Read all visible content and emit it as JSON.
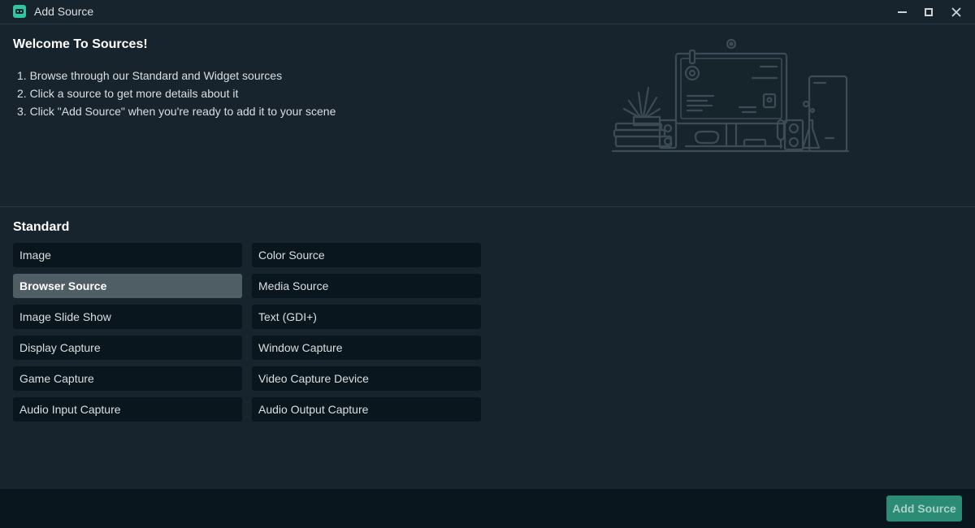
{
  "window": {
    "title": "Add Source",
    "icon": "streamlabs-robot-icon"
  },
  "welcome": {
    "title": "Welcome To Sources!",
    "steps": [
      "1. Browse through our Standard and Widget sources",
      "2. Click a source to get more details about it",
      "3. Click \"Add Source\" when you're ready to add it to your scene"
    ],
    "illustration": "desk-setup-illustration"
  },
  "standard": {
    "title": "Standard",
    "sources": [
      "Image",
      "Color Source",
      "Browser Source",
      "Media Source",
      "Image Slide Show",
      "Text (GDI+)",
      "Display Capture",
      "Window Capture",
      "Game Capture",
      "Video Capture Device",
      "Audio Input Capture",
      "Audio Output Capture"
    ],
    "selected": "Browser Source"
  },
  "footer": {
    "add_button_label": "Add Source"
  },
  "colors": {
    "background": "#17242d",
    "button_background": "#09161d",
    "selected_background": "#4f5e65",
    "accent": "#31c3a2",
    "add_button": "#2b8b74"
  }
}
